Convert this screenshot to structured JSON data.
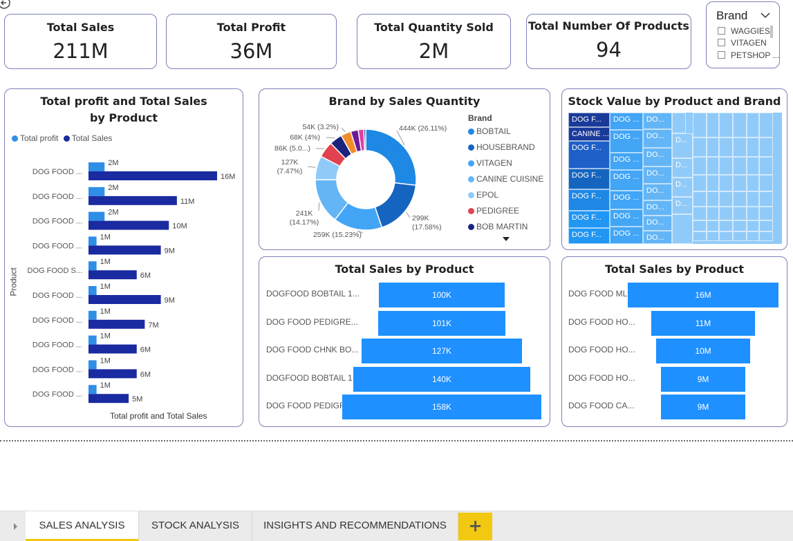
{
  "kpis": {
    "total_sales": {
      "title": "Total Sales",
      "value": "211M"
    },
    "total_profit": {
      "title": "Total Profit",
      "value": "36M"
    },
    "total_quantity": {
      "title": "Total Quantity Sold",
      "value": "2M"
    },
    "total_products": {
      "title": "Total Number Of Products",
      "value": "94"
    }
  },
  "brand_slicer": {
    "title": "Brand",
    "items": [
      "WAGGIES",
      "VITAGEN",
      "PETSHOP ..."
    ]
  },
  "profit_sales_chart": {
    "title": "Total profit and Total Sales by Product",
    "legend": [
      "Total profit",
      "Total Sales"
    ],
    "ylabel": "Product",
    "xlabel": "Total profit and Total Sales"
  },
  "donut_chart": {
    "title": "Brand by Sales Quantity",
    "legend_title": "Brand"
  },
  "treemap": {
    "title": "Stock Value by Product and Brand"
  },
  "funnel_left": {
    "title": "Total Sales by Product"
  },
  "funnel_right": {
    "title": "Total Sales by Product"
  },
  "tabs": [
    "SALES ANALYSIS",
    "STOCK ANALYSIS",
    "INSIGHTS AND RECOMMENDATIONS"
  ],
  "add_tab": "+",
  "colors": {
    "dark_blue": "#1a2aa0",
    "light_blue": "#2f8ee6",
    "funnel_blue": "#1e90ff",
    "card_border": "#7b7fb8",
    "tab_accent": "#f2c811"
  },
  "chart_data": [
    {
      "type": "bar",
      "title": "Total profit and Total Sales by Product",
      "categories": [
        "DOG FOOD ...",
        "DOG FOOD ...",
        "DOG FOOD ...",
        "DOG FOOD ...",
        "DOG FOOD S...",
        "DOG FOOD ...",
        "DOG FOOD ...",
        "DOG FOOD ...",
        "DOG FOOD ...",
        "DOG FOOD ..."
      ],
      "series": [
        {
          "name": "Total profit",
          "color": "#2f8ee6",
          "values": [
            2,
            2,
            2,
            1,
            1,
            1,
            1,
            1,
            1,
            1
          ],
          "labels": [
            "2M",
            "2M",
            "2M",
            "1M",
            "1M",
            "1M",
            "1M",
            "1M",
            "1M",
            "1M"
          ]
        },
        {
          "name": "Total Sales",
          "color": "#1a2aa0",
          "values": [
            16,
            11,
            10,
            9,
            6,
            9,
            7,
            6,
            6,
            5
          ],
          "labels": [
            "16M",
            "11M",
            "10M",
            "9M",
            "6M",
            "9M",
            "7M",
            "6M",
            "6M",
            "5M"
          ]
        }
      ],
      "xlabel": "Total profit and Total Sales",
      "ylabel": "Product"
    },
    {
      "type": "pie",
      "title": "Brand by Sales Quantity",
      "slices": [
        {
          "name": "BOBTAIL",
          "value": 444,
          "label": "444K (26.11%)",
          "color": "#1e88e5"
        },
        {
          "name": "HOUSEBRAND",
          "value": 299,
          "label": "299K (17.58%)",
          "color": "#1565c0"
        },
        {
          "name": "VITAGEN",
          "value": 259,
          "label": "259K (15.23%)",
          "color": "#42a5f5"
        },
        {
          "name": "CANINE CUISINE",
          "value": 241,
          "label": "241K (14.17%)",
          "color": "#64b5f6"
        },
        {
          "name": "EPOL",
          "value": 127,
          "label": "127K (7.47%)",
          "color": "#90caf9"
        },
        {
          "name": "PEDIGREE",
          "value": 86,
          "label": "86K (5.0...)",
          "color": "#e0434f"
        },
        {
          "name": "BOB MARTIN",
          "value": 68,
          "label": "68K (4%)",
          "color": "#1a237e"
        },
        {
          "name": "",
          "value": 54,
          "label": "54K (3.2%)",
          "color": "#f08c2a"
        },
        {
          "name": "",
          "value": 40,
          "label": "",
          "color": "#6a1b9a"
        },
        {
          "name": "",
          "value": 30,
          "label": "",
          "color": "#e040a0"
        },
        {
          "name": "",
          "value": 10,
          "label": "",
          "color": "#283593"
        }
      ],
      "legend": [
        "BOBTAIL",
        "HOUSEBRAND",
        "VITAGEN",
        "CANINE CUISINE",
        "EPOL",
        "PEDIGREE",
        "BOB MARTIN"
      ]
    },
    {
      "type": "bar",
      "title": "Total Sales by Product",
      "categories": [
        "DOGFOOD BOBTAIL 1...",
        "DOG FOOD PEDIGRE...",
        "DOG FOOD CHNK BO...",
        "DOGFOOD BOBTAIL 1...",
        "DOG FOOD PEDIGRE..."
      ],
      "values": [
        100,
        101,
        127,
        140,
        158
      ],
      "labels": [
        "100K",
        "101K",
        "127K",
        "140K",
        "158K"
      ]
    },
    {
      "type": "bar",
      "title": "Total Sales by Product",
      "categories": [
        "DOG FOOD ML...",
        "DOG FOOD HO...",
        "DOG FOOD HO...",
        "DOG FOOD HO...",
        "DOG FOOD CA..."
      ],
      "values": [
        16,
        11,
        10,
        9,
        9
      ],
      "labels": [
        "16M",
        "11M",
        "10M",
        "9M",
        "9M"
      ]
    }
  ]
}
